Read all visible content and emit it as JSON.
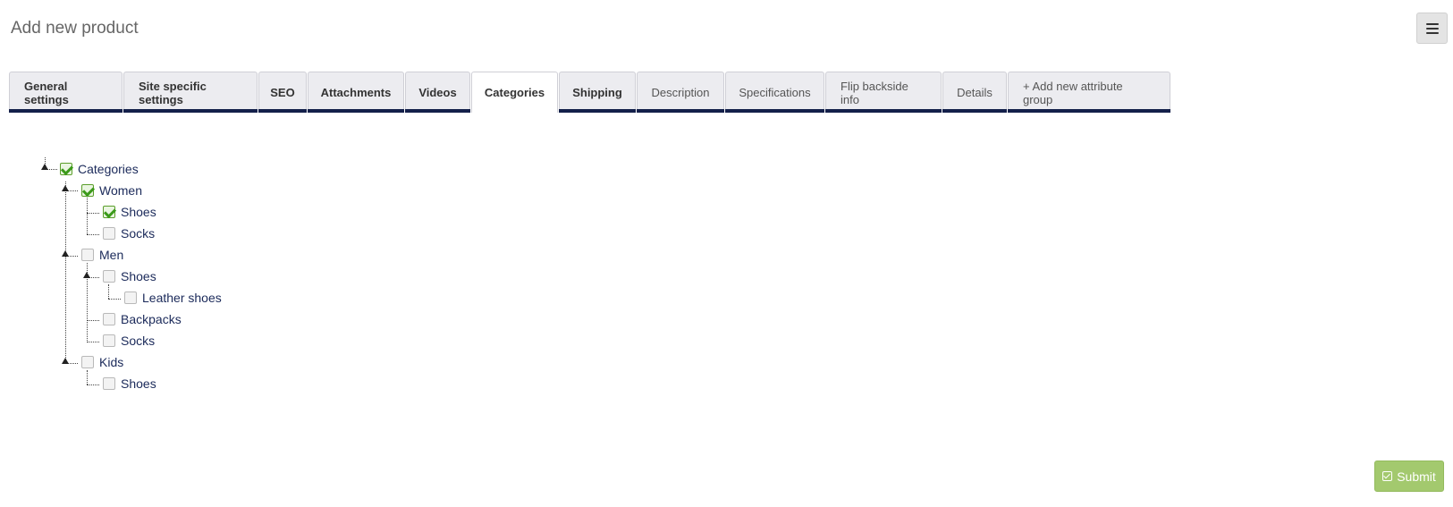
{
  "page": {
    "title": "Add new product"
  },
  "header": {
    "menu_icon": "hamburger-menu-icon"
  },
  "tabs": [
    {
      "label": "General settings",
      "active": false
    },
    {
      "label": "Site specific settings",
      "active": false
    },
    {
      "label": "SEO",
      "active": false
    },
    {
      "label": "Attachments",
      "active": false
    },
    {
      "label": "Videos",
      "active": false
    },
    {
      "label": "Categories",
      "active": true
    },
    {
      "label": "Shipping",
      "active": false
    },
    {
      "label": "Description",
      "active": false
    },
    {
      "label": "Specifications",
      "active": false
    },
    {
      "label": "Flip backside info",
      "active": false
    },
    {
      "label": "Details",
      "active": false
    },
    {
      "label": "+ Add new attribute group",
      "active": false
    }
  ],
  "tree": {
    "root": {
      "label": "Categories",
      "checked": true
    },
    "nodes": [
      {
        "label": "Women",
        "checked": true
      },
      {
        "label": "Shoes",
        "checked": true
      },
      {
        "label": "Socks",
        "checked": false
      },
      {
        "label": "Men",
        "checked": false
      },
      {
        "label": "Shoes",
        "checked": false
      },
      {
        "label": "Leather shoes",
        "checked": false
      },
      {
        "label": "Backpacks",
        "checked": false
      },
      {
        "label": "Socks",
        "checked": false
      },
      {
        "label": "Kids",
        "checked": false
      },
      {
        "label": "Shoes",
        "checked": false
      }
    ]
  },
  "footer": {
    "submit_label": "Submit"
  },
  "colors": {
    "accent": "#14204a",
    "submit": "#a3c96e",
    "check": "#3b9a1a"
  }
}
